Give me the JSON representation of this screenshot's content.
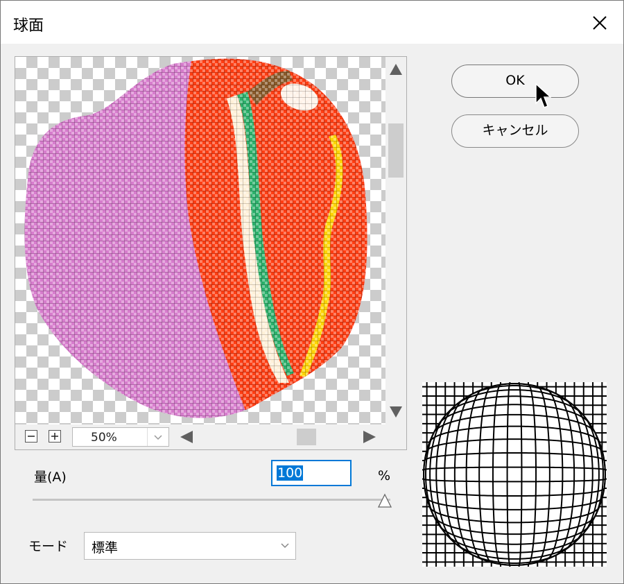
{
  "dialog": {
    "title": "球面"
  },
  "preview": {
    "zoom_value": "50%"
  },
  "buttons": {
    "ok": "OK",
    "cancel": "キャンセル"
  },
  "amount": {
    "label": "量(A)",
    "value": "100",
    "unit": "%",
    "level_percent": 100
  },
  "mode": {
    "label": "モード",
    "value": "標準"
  },
  "icons": {
    "close": "close-icon",
    "zoom_out": "minus-icon",
    "zoom_in": "plus-icon",
    "dropdown": "chevron-down-icon",
    "cursor": "mouse-pointer-icon"
  },
  "colors": {
    "accent": "#0078d7"
  }
}
